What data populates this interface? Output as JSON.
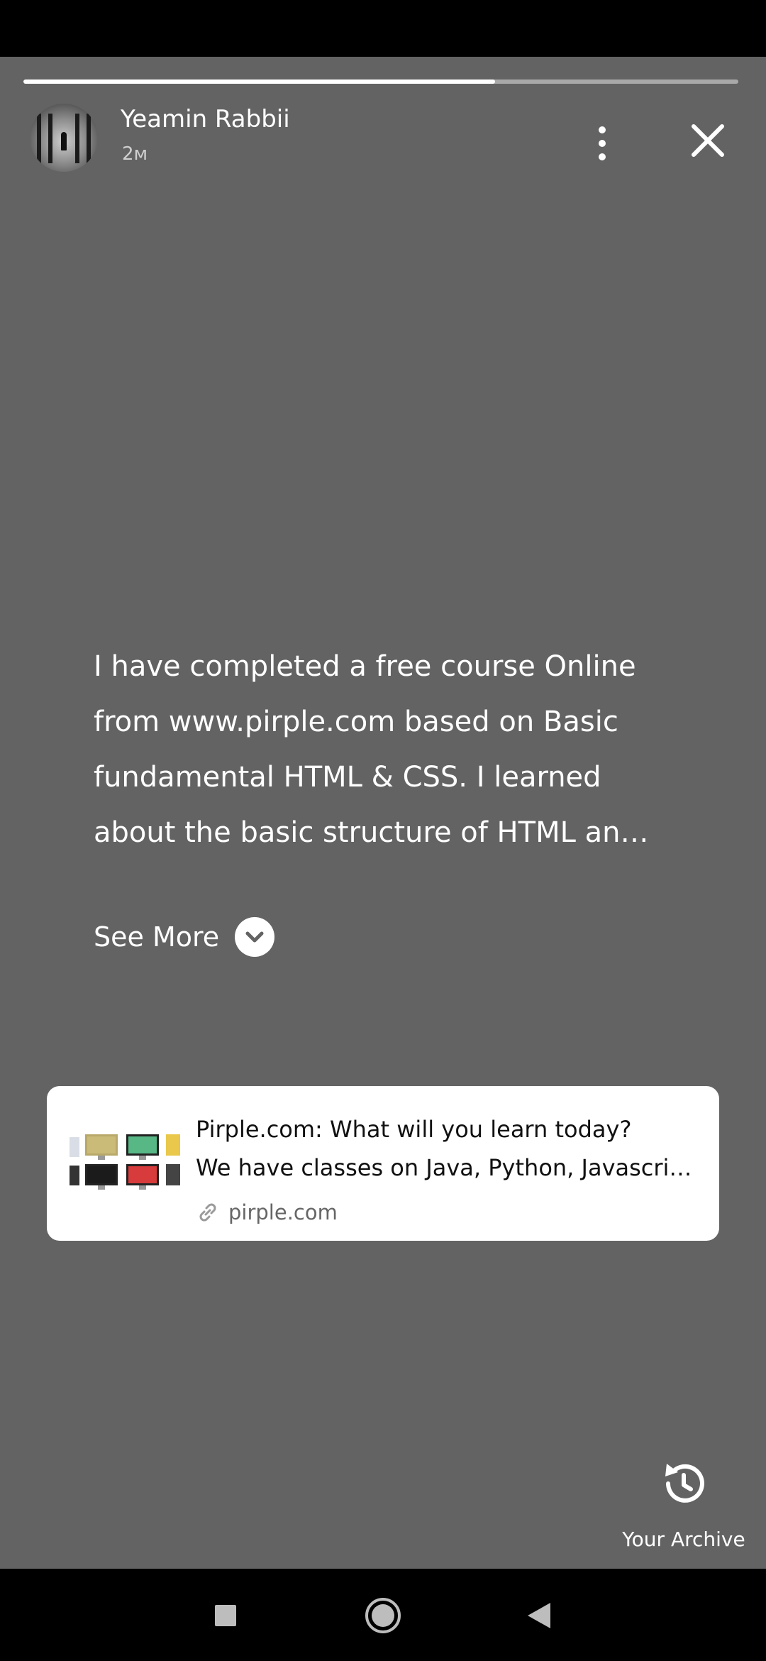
{
  "story": {
    "progress": 0.66,
    "user_name": "Yeamin Rabbii",
    "timestamp": "2м",
    "caption_lines": [
      "I have completed a free course Online",
      "from www.pirple.com based on Basic",
      "fundamental HTML & CSS. I learned",
      "about the basic structure of HTML an…"
    ],
    "see_more_label": "See More",
    "see_more_icon": "chevron-down-icon",
    "more_icon": "more-vertical-icon",
    "close_icon": "close-icon"
  },
  "link_preview": {
    "title": "Pirple.com: What will you learn today?",
    "description": "We have classes on Java, Python, Javascript, Node.js, Swift and more",
    "domain": "pirple.com",
    "domain_icon": "link-icon"
  },
  "archive": {
    "label": "Your Archive",
    "icon": "archive-history-icon"
  },
  "nav": {
    "recents_icon": "square-icon",
    "home_icon": "circle-icon",
    "back_icon": "triangle-back-icon"
  },
  "colors": {
    "background": "#636363",
    "card": "#ffffff",
    "text": "#ffffff"
  }
}
